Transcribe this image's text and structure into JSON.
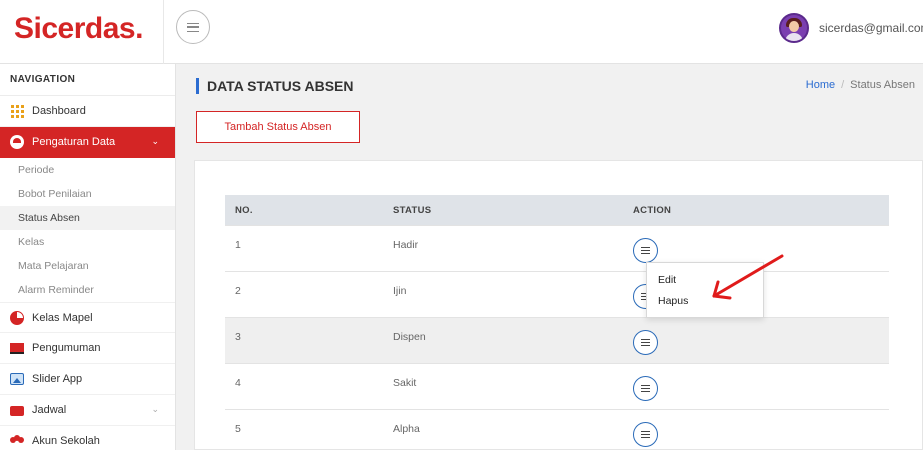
{
  "header": {
    "brand": "Sicerdas.",
    "user_email": "sicerdas@gmail.com",
    "caret": "⌄"
  },
  "sidebar": {
    "nav_header": "NAVIGATION",
    "items": [
      {
        "label": "Dashboard",
        "icon": "grid-icon"
      },
      {
        "label": "Pengaturan Data",
        "icon": "pie-circle-icon",
        "active": true,
        "expanded": true
      },
      {
        "label": "Kelas Mapel",
        "icon": "pie-icon"
      },
      {
        "label": "Pengumuman",
        "icon": "board-icon"
      },
      {
        "label": "Slider App",
        "icon": "image-icon"
      },
      {
        "label": "Jadwal",
        "icon": "briefcase-icon",
        "has_submenu": true
      },
      {
        "label": "Akun Sekolah",
        "icon": "people-icon"
      }
    ],
    "sub_items": [
      {
        "label": "Periode"
      },
      {
        "label": "Bobot Penilaian"
      },
      {
        "label": "Status Absen",
        "current": true
      },
      {
        "label": "Kelas"
      },
      {
        "label": "Mata Pelajaran"
      },
      {
        "label": "Alarm Reminder"
      }
    ]
  },
  "main": {
    "page_title": "DATA STATUS ABSEN",
    "breadcrumb": {
      "home": "Home",
      "separator": "/",
      "current": "Status Absen"
    },
    "add_button": "Tambah Status Absen",
    "table": {
      "columns": [
        "NO.",
        "STATUS",
        "ACTION"
      ],
      "rows": [
        {
          "no": "1",
          "status": "Hadir"
        },
        {
          "no": "2",
          "status": "Ijin"
        },
        {
          "no": "3",
          "status": "Dispen"
        },
        {
          "no": "4",
          "status": "Sakit"
        },
        {
          "no": "5",
          "status": "Alpha"
        }
      ]
    },
    "action_menu": {
      "edit": "Edit",
      "delete": "Hapus"
    }
  },
  "colors": {
    "brand_red": "#d42525",
    "accent_blue": "#2b6cd1",
    "annotation_red": "#e01b1b"
  }
}
